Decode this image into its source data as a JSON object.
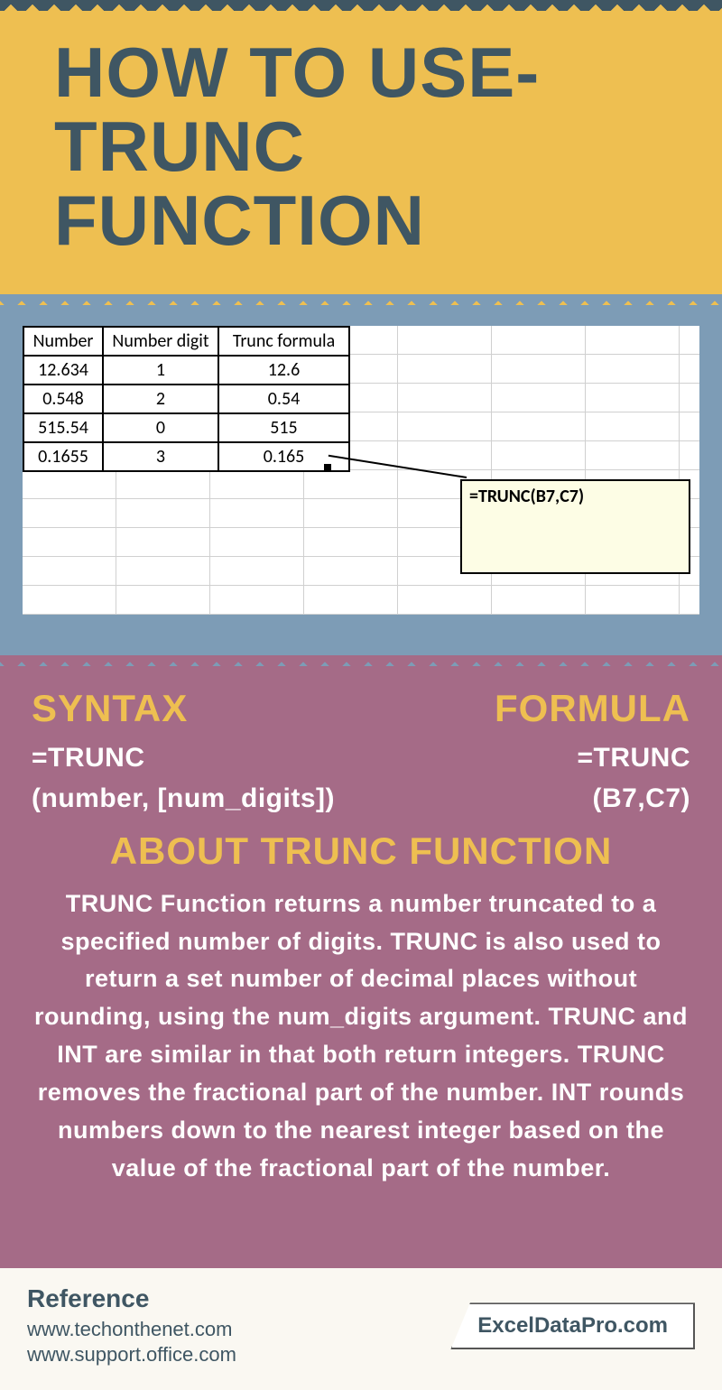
{
  "title": "HOW TO USE- TRUNC FUNCTION",
  "table": {
    "headers": [
      "Number",
      "Number digit",
      "Trunc formula"
    ],
    "rows": [
      [
        "12.634",
        "1",
        "12.6"
      ],
      [
        "0.548",
        "2",
        "0.54"
      ],
      [
        "515.54",
        "0",
        "515"
      ],
      [
        "0.1655",
        "3",
        "0.165"
      ]
    ]
  },
  "callout": "=TRUNC(B7,C7)",
  "syntax": {
    "label": "SYNTAX",
    "line1": "=TRUNC",
    "line2": "(number, [num_digits])"
  },
  "formula": {
    "label": "FORMULA",
    "line1": "=TRUNC",
    "line2": "(B7,C7)"
  },
  "about": {
    "heading": "ABOUT TRUNC FUNCTION",
    "text": "TRUNC Function returns a number truncated to a specified number of digits. TRUNC is also used to return a set number of decimal places without rounding, using the num_digits argument. TRUNC and INT are similar in that both return integers. TRUNC removes the fractional part of the number. INT rounds numbers down to the nearest integer based on the value of the fractional part of the number."
  },
  "reference": {
    "label": "Reference",
    "link1": "www.techonthenet.com",
    "link2": "www.support.office.com"
  },
  "brand": "ExcelDataPro.com"
}
